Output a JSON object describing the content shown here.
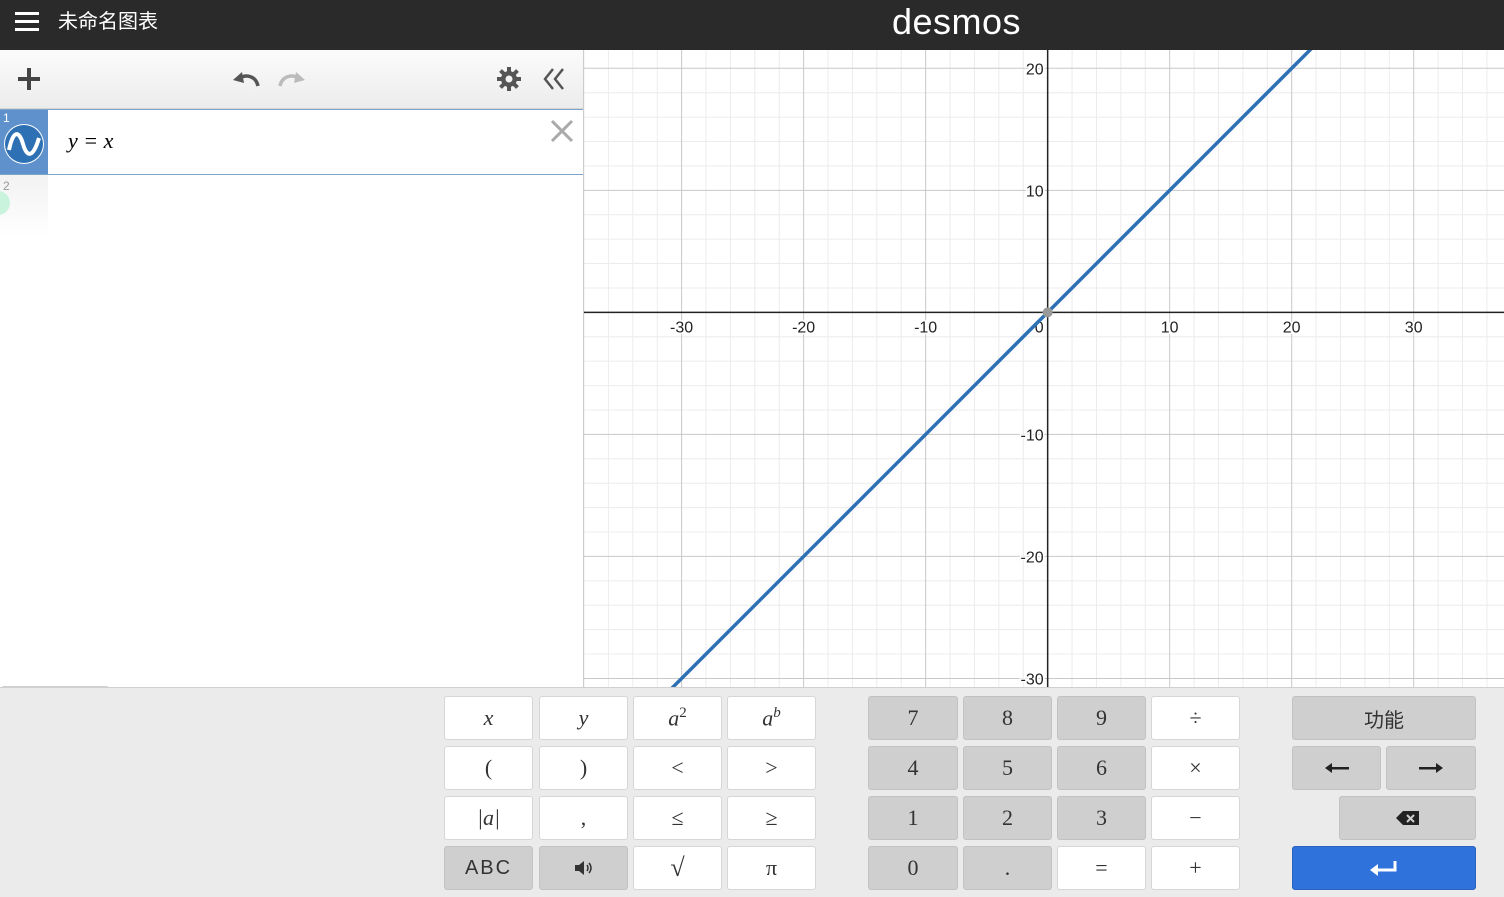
{
  "app": {
    "title": "未命名图表",
    "brand": "desmos"
  },
  "expressions": [
    {
      "index": "1",
      "latex": "y = x",
      "color": "#2d70b3"
    },
    {
      "index": "2",
      "latex": ""
    }
  ],
  "graph_axes": {
    "x_tick_labels": [
      "-30",
      "-20",
      "-10",
      "0",
      "10",
      "20",
      "30"
    ],
    "y_tick_labels": [
      "20",
      "10",
      "-10",
      "-20",
      "-30"
    ]
  },
  "chart_data": {
    "type": "line",
    "title": "",
    "xlabel": "",
    "ylabel": "",
    "xlim": [
      -38,
      37.4
    ],
    "ylim": [
      -30.7,
      21.5
    ],
    "grid": true,
    "series": [
      {
        "name": "y = x",
        "color": "#2d70b3",
        "x": [
          -38,
          37.4
        ],
        "y": [
          -38,
          37.4
        ]
      }
    ]
  },
  "keypad": {
    "letters": {
      "x": "x",
      "y": "y",
      "a": "a",
      "exp2": "2",
      "expb": "b",
      "abs": "|a|",
      "abc": "ABC"
    },
    "symbols": {
      "lparen": "(",
      "rparen": ")",
      "lt": "<",
      "gt": ">",
      "comma": ",",
      "le": "≤",
      "ge": "≥",
      "sqrt": "√",
      "pi": "π"
    },
    "numbers": {
      "n7": "7",
      "n8": "8",
      "n9": "9",
      "div": "÷",
      "n4": "4",
      "n5": "5",
      "n6": "6",
      "mul": "×",
      "n1": "1",
      "n2": "2",
      "n3": "3",
      "minus": "−",
      "n0": "0",
      "dot": ".",
      "eq": "=",
      "plus": "+"
    },
    "functions_label": "功能"
  }
}
